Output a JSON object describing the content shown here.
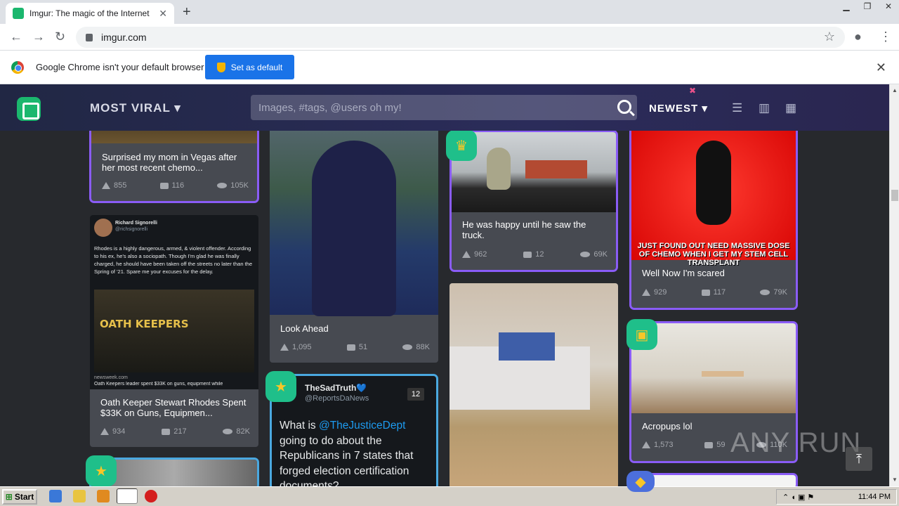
{
  "browser": {
    "tab_title": "Imgur: The magic of the Internet",
    "new_tab": "+",
    "url": "imgur.com",
    "infobar_text": "Google Chrome isn't your default browser",
    "set_default_label": "Set as default"
  },
  "imgur": {
    "section": "MOST VIRAL",
    "search_placeholder": "Images, #tags, @users oh my!",
    "sort": "NEWEST"
  },
  "cards": [
    {
      "title": "Surprised my mom in Vegas after her most recent chemo...",
      "ups": "855",
      "comments": "116",
      "views": "105K"
    },
    {
      "title": "Look Ahead",
      "ups": "1,095",
      "comments": "51",
      "views": "88K"
    },
    {
      "title": "He was happy until he saw the truck.",
      "ups": "962",
      "comments": "12",
      "views": "69K"
    },
    {
      "title": "Well Now I'm scared",
      "ups": "929",
      "comments": "117",
      "views": "79K",
      "meme_text": "JUST FOUND OUT NEED MASSIVE DOSE OF CHEMO WHEN I GET MY STEM CELL TRANSPLANT"
    },
    {
      "title": "Oath Keeper Stewart Rhodes Spent $33K on Guns, Equipmen...",
      "ups": "934",
      "comments": "217",
      "views": "82K"
    },
    {
      "title": "Acropups lol",
      "ups": "1,573",
      "comments": "59",
      "views": "110K"
    }
  ],
  "tweet_card": {
    "author": "Richard Signorelli",
    "handle": "@richsignorelli",
    "text": "Rhodes is a highly dangerous, armed, & violent offender. According to his ex, he's also a sociopath. Though I'm glad he was finally charged, he should have been taken off the streets no later than the Spring of '21. Spare me your excuses for the delay.",
    "shirt": "OATH KEEPERS",
    "source": "newsweek.com",
    "headline": "Oath Keepers leader spent $33K on guns, equipment while"
  },
  "sadtruth": {
    "author": "TheSadTruth💙",
    "handle": "@ReportsDaNews",
    "count": "12",
    "mention": "@TheJusticeDept",
    "text_before": "What is ",
    "text_after": " going to do about the Republicans in 7 states that forged election certification documents?"
  },
  "watermark": "ANY RUN",
  "taskbar": {
    "start": "Start",
    "clock": "11:44 PM"
  }
}
